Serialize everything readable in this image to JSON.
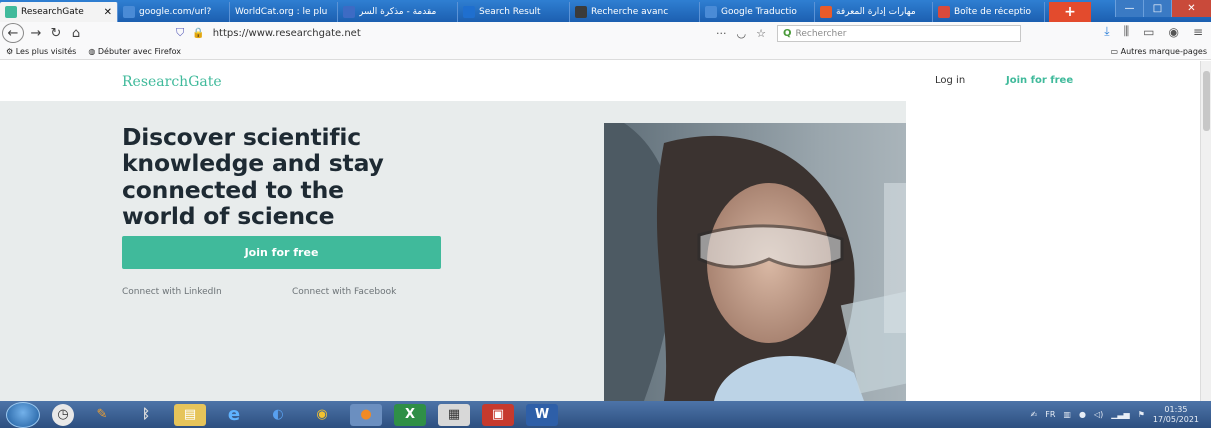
{
  "tabs": [
    {
      "label": "ResearchGate",
      "color": "#40ba9b",
      "active": true
    },
    {
      "label": "google.com/url?",
      "color": "#4a8bd6"
    },
    {
      "label": "WorldCat.org : le plu",
      "color": "#e9e9e9"
    },
    {
      "label": "مقدمة - مذكرة السر",
      "color": "#3d6bc4"
    },
    {
      "label": "Search Result",
      "color": "#1f6fcf"
    },
    {
      "label": "Recherche avanc",
      "color": "#3b3b3b"
    },
    {
      "label": "Google Traductio",
      "color": "#4a8bd6"
    },
    {
      "label": "مهارات إدارة المعرفة",
      "color": "#e85b2a"
    },
    {
      "label": "Boîte de réceptio",
      "color": "#d94a3c"
    }
  ],
  "browser": {
    "url": "https://www.researchgate.net",
    "search_placeholder": "Rechercher",
    "bookmarks": [
      "Les plus visités",
      "Débuter avec Firefox"
    ],
    "other_bookmarks": "Autres marque-pages"
  },
  "page": {
    "logo": "ResearchGate",
    "login": "Log in",
    "join_link": "Join for free",
    "headline_lines": [
      "Discover scientific",
      "knowledge and stay",
      "connected to the",
      "world of science"
    ],
    "cta": "Join for free",
    "connect_linkedin": "Connect with LinkedIn",
    "connect_facebook": "Connect with Facebook"
  },
  "taskbar": {
    "lang": "FR",
    "time": "01:35",
    "date": "17/05/2021"
  },
  "colors": {
    "accent": "#40ba9b",
    "hero_bg": "#e8ecec",
    "heading": "#1e2a33"
  }
}
